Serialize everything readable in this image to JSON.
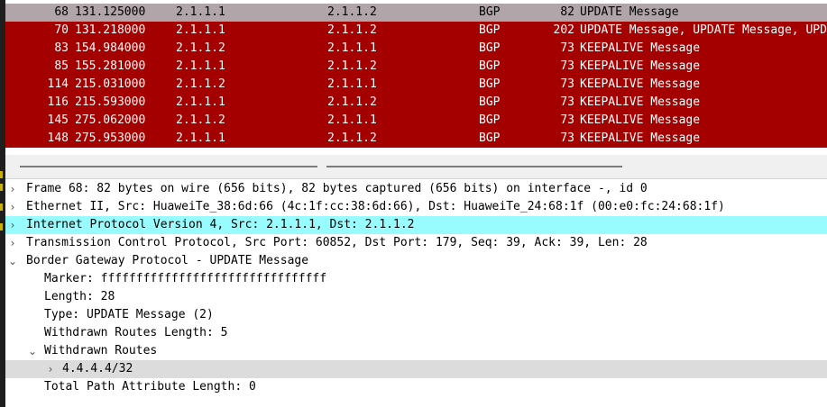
{
  "packet_list": {
    "rows": [
      {
        "no": "68",
        "time": "131.125000",
        "src": "2.1.1.1",
        "dst": "2.1.1.2",
        "proto": "BGP",
        "len": "82",
        "info": "UPDATE Message",
        "selected": true
      },
      {
        "no": "70",
        "time": "131.218000",
        "src": "2.1.1.1",
        "dst": "2.1.1.2",
        "proto": "BGP",
        "len": "202",
        "info": "UPDATE Message, UPDATE Message, UPD",
        "selected": false
      },
      {
        "no": "83",
        "time": "154.984000",
        "src": "2.1.1.2",
        "dst": "2.1.1.1",
        "proto": "BGP",
        "len": "73",
        "info": "KEEPALIVE Message",
        "selected": false
      },
      {
        "no": "85",
        "time": "155.281000",
        "src": "2.1.1.1",
        "dst": "2.1.1.2",
        "proto": "BGP",
        "len": "73",
        "info": "KEEPALIVE Message",
        "selected": false
      },
      {
        "no": "114",
        "time": "215.031000",
        "src": "2.1.1.2",
        "dst": "2.1.1.1",
        "proto": "BGP",
        "len": "73",
        "info": "KEEPALIVE Message",
        "selected": false
      },
      {
        "no": "116",
        "time": "215.593000",
        "src": "2.1.1.1",
        "dst": "2.1.1.2",
        "proto": "BGP",
        "len": "73",
        "info": "KEEPALIVE Message",
        "selected": false
      },
      {
        "no": "145",
        "time": "275.062000",
        "src": "2.1.1.2",
        "dst": "2.1.1.1",
        "proto": "BGP",
        "len": "73",
        "info": "KEEPALIVE Message",
        "selected": false
      },
      {
        "no": "148",
        "time": "275.953000",
        "src": "2.1.1.1",
        "dst": "2.1.1.2",
        "proto": "BGP",
        "len": "73",
        "info": "KEEPALIVE Message",
        "selected": false
      }
    ]
  },
  "details": {
    "frame": "Frame 68: 82 bytes on wire (656 bits), 82 bytes captured (656 bits) on interface -, id 0",
    "ethernet": "Ethernet II, Src: HuaweiTe_38:6d:66 (4c:1f:cc:38:6d:66), Dst: HuaweiTe_24:68:1f (00:e0:fc:24:68:1f)",
    "ipv4": "Internet Protocol Version 4, Src: 2.1.1.1, Dst: 2.1.1.2",
    "tcp": "Transmission Control Protocol, Src Port: 60852, Dst Port: 179, Seq: 39, Ack: 39, Len: 28",
    "bgp": "Border Gateway Protocol - UPDATE Message",
    "marker": "Marker: ffffffffffffffffffffffffffffffff",
    "length": "Length: 28",
    "type": "Type: UPDATE Message (2)",
    "withdrawn_len": "Withdrawn Routes Length: 5",
    "withdrawn_routes": "Withdrawn Routes",
    "route": "4.4.4.4/32",
    "total_path_attr": "Total Path Attribute Length: 0"
  },
  "icons": {
    "collapsed": "chevron-right-icon",
    "expanded": "chevron-down-icon"
  },
  "colors": {
    "bad_tcp_row": "#a40000",
    "selected_row": "#b1a5a9",
    "highlight_field": "#98fbfd"
  }
}
